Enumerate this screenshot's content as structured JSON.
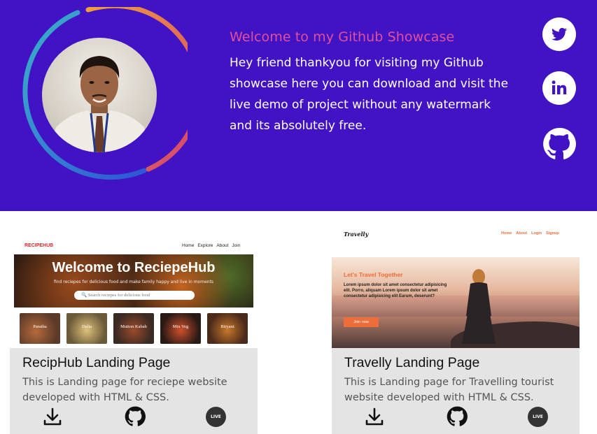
{
  "hero": {
    "welcome": "Welcome to my Github Showcase",
    "intro": "Hey friend thankyou for visiting my Github showcase here you can download and visit the live demo of project without any watermark and its absolutely free.",
    "background": "#4213c5",
    "accent": "#e0509a"
  },
  "social": [
    {
      "name": "twitter",
      "icon": "twitter-icon"
    },
    {
      "name": "linkedin",
      "icon": "linkedin-icon"
    },
    {
      "name": "github",
      "icon": "github-icon"
    }
  ],
  "cards": [
    {
      "title": "RecipHub Landing Page",
      "description": "This is Landing page for reciepe website developed with HTML & CSS.",
      "live_label": "LIVE",
      "preview": {
        "logo": "RECIPEHUB",
        "nav": [
          "Home",
          "Explore",
          "About",
          "Join"
        ],
        "headline": "Welcome to ReciepeHub",
        "subline": "find reciepes for delicious food and make family happy and live in moments",
        "search_placeholder": "Search reciepes for delicious food",
        "thumbs": [
          "Paratha",
          "Dalia",
          "Mutton Kabab",
          "Mix Veg",
          "Biryani"
        ]
      }
    },
    {
      "title": "Travelly Landing Page",
      "description": "This is Landing page for Travelling tourist website developed with HTML & CSS.",
      "live_label": "LIVE",
      "preview": {
        "logo": "Travelly",
        "nav": [
          "Home",
          "About",
          "Login",
          "Signup"
        ],
        "tagline": "Let's Travel Together",
        "lorem": "Lorem ipsum dolor sit amet consectetur adipisicing elit. Porro, aliquam Lorem ipsum dolor sit amet consectetur adipisicing elit Earum, deserunt?",
        "button": "Join now"
      }
    }
  ]
}
